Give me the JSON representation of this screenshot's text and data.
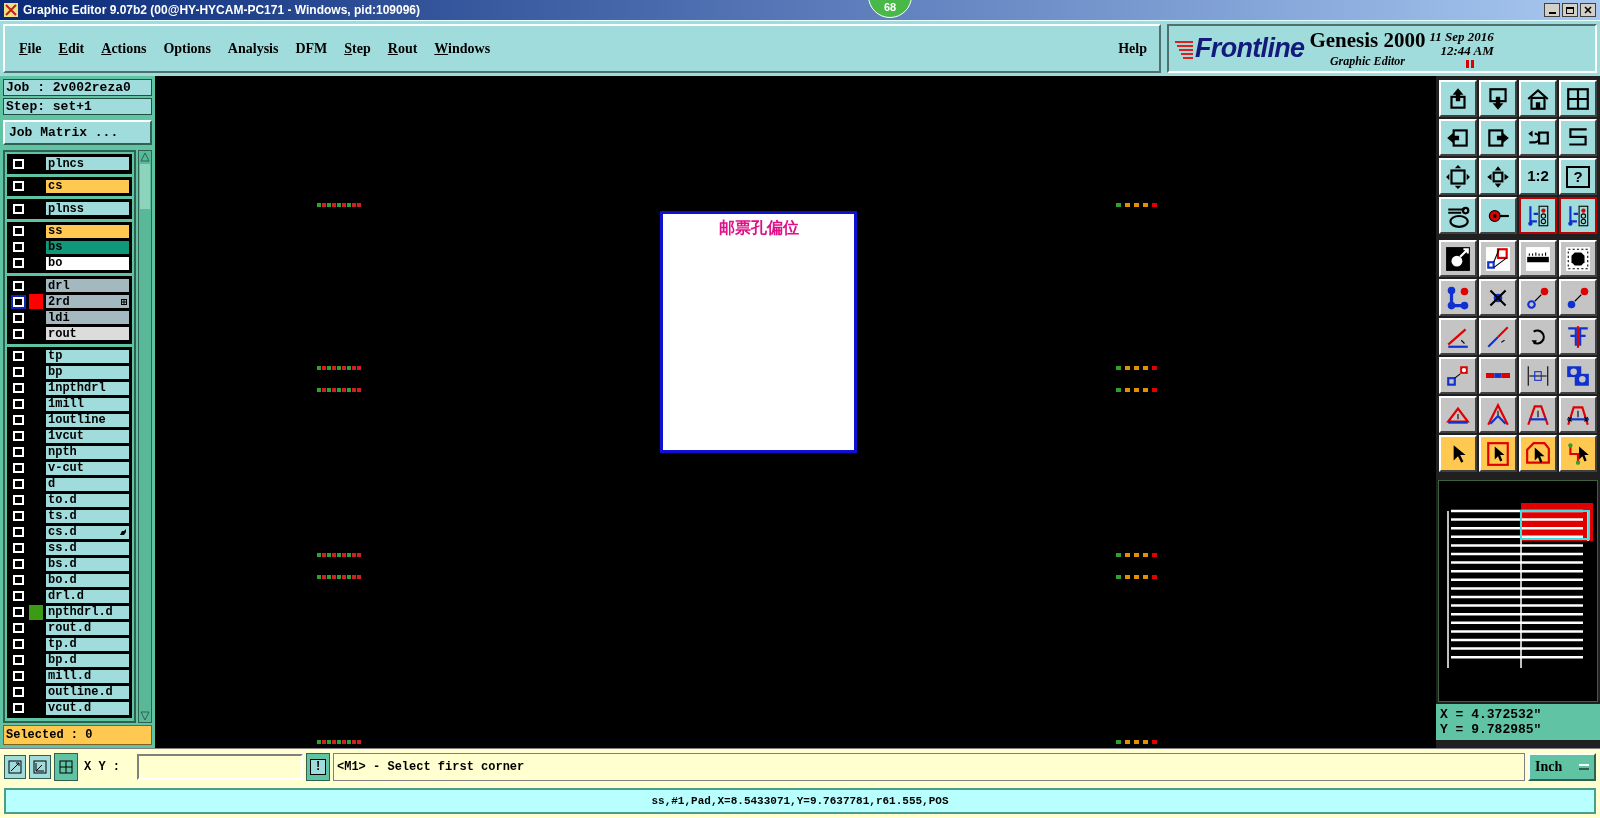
{
  "title_bar": {
    "title": "Graphic Editor 9.07b2 (00@HY-HYCAM-PC171 - Windows, pid:109096)",
    "badge": "68"
  },
  "menu": [
    {
      "label": "File",
      "underline_first": true
    },
    {
      "label": "Edit",
      "underline_first": true
    },
    {
      "label": "Actions",
      "underline_first": true
    },
    {
      "label": "Options",
      "underline_first": false
    },
    {
      "label": "Analysis",
      "underline_first": false
    },
    {
      "label": "DFM",
      "underline_first": false
    },
    {
      "label": "Step",
      "underline_first": true
    },
    {
      "label": "Rout",
      "underline_first": true
    },
    {
      "label": "Windows",
      "underline_first": true
    }
  ],
  "help": "Help",
  "brand": {
    "logo": "Frontline",
    "product": "Genesis 2000",
    "subtitle": "Graphic Editor",
    "date": "11 Sep 2016",
    "time": "12:44 AM"
  },
  "job": {
    "job": "Job : 2v002reza0",
    "step": "Step: set+1",
    "matrix_button": "Job Matrix ..."
  },
  "layer_groups": [
    [
      {
        "name": "plncs",
        "kind": "document",
        "selected": false
      }
    ],
    [
      {
        "name": "cs",
        "kind": "signal",
        "selected": false
      }
    ],
    [
      {
        "name": "plnss",
        "kind": "document",
        "selected": false
      }
    ],
    [
      {
        "name": "ss",
        "kind": "signal",
        "selected": false
      },
      {
        "name": "bs",
        "kind": "mask",
        "selected": false
      },
      {
        "name": "bo",
        "kind": "silk",
        "selected": false
      }
    ],
    [
      {
        "name": "drl",
        "kind": "drill",
        "selected": false
      },
      {
        "name": "2rd",
        "kind": "drill",
        "selected": true,
        "color": "#ff0000",
        "has_attributes": true
      },
      {
        "name": "ldi",
        "kind": "drill",
        "selected": false
      },
      {
        "name": "rout",
        "kind": "rout",
        "selected": false
      }
    ],
    [
      {
        "name": "tp",
        "kind": "document",
        "selected": false
      },
      {
        "name": "bp",
        "kind": "document",
        "selected": false
      },
      {
        "name": "1npthdrl",
        "kind": "document",
        "selected": false
      },
      {
        "name": "1mill",
        "kind": "document",
        "selected": false
      },
      {
        "name": "1outline",
        "kind": "document",
        "selected": false
      },
      {
        "name": "1vcut",
        "kind": "document",
        "selected": false
      },
      {
        "name": "npth",
        "kind": "document",
        "selected": false
      },
      {
        "name": "v-cut",
        "kind": "document",
        "selected": false
      },
      {
        "name": "d",
        "kind": "document",
        "selected": false
      },
      {
        "name": "to.d",
        "kind": "document",
        "selected": false
      },
      {
        "name": "ts.d",
        "kind": "document",
        "selected": false
      },
      {
        "name": "cs.d",
        "kind": "document",
        "selected": false,
        "has_pointer": true
      },
      {
        "name": "ss.d",
        "kind": "document",
        "selected": false
      },
      {
        "name": "bs.d",
        "kind": "document",
        "selected": false
      },
      {
        "name": "bo.d",
        "kind": "document",
        "selected": false
      },
      {
        "name": "drl.d",
        "kind": "document",
        "selected": false
      },
      {
        "name": "npthdrl.d",
        "kind": "document",
        "selected": false,
        "color": "#3c9a14"
      },
      {
        "name": "rout.d",
        "kind": "document",
        "selected": false
      },
      {
        "name": "tp.d",
        "kind": "document",
        "selected": false
      },
      {
        "name": "bp.d",
        "kind": "document",
        "selected": false
      },
      {
        "name": "mill.d",
        "kind": "document",
        "selected": false
      },
      {
        "name": "outline.d",
        "kind": "document",
        "selected": false
      },
      {
        "name": "vcut.d",
        "kind": "document",
        "selected": false
      }
    ]
  ],
  "selected_count": "Selected : 0",
  "canvas": {
    "note": "邮票孔偏位"
  },
  "toolbar": [
    {
      "kind": "view",
      "rows": [
        [
          {
            "kind": "export-up",
            "active": false
          },
          {
            "kind": "import-down",
            "active": false
          },
          {
            "kind": "home",
            "active": false
          },
          {
            "kind": "grid-xy",
            "active": false
          }
        ],
        [
          {
            "kind": "arrow-left",
            "active": false
          },
          {
            "kind": "arrow-right",
            "active": false
          },
          {
            "kind": "undo",
            "active": false
          },
          {
            "kind": "snake",
            "active": false
          }
        ],
        [
          {
            "kind": "zoom-out",
            "active": false
          },
          {
            "kind": "zoom-center",
            "active": false
          },
          {
            "kind": "label",
            "label": "1:2",
            "active": false
          },
          {
            "kind": "label-framed",
            "label": "?",
            "active": false
          }
        ],
        [
          {
            "kind": "tools",
            "active": false
          },
          {
            "kind": "probe",
            "active": false
          },
          {
            "kind": "circuit",
            "active": true
          },
          {
            "kind": "circuit",
            "active": true
          }
        ]
      ]
    },
    {
      "kind": "edit",
      "rows": [
        [
          {
            "kind": "pad-select",
            "active": false
          },
          {
            "kind": "copy-shape",
            "active": false
          },
          {
            "kind": "ruler",
            "active": false
          },
          {
            "kind": "dashed-pad",
            "active": false
          }
        ],
        [
          {
            "kind": "nodes",
            "active": false
          },
          {
            "kind": "cross-pad",
            "active": false
          },
          {
            "kind": "link-hollow",
            "active": false
          },
          {
            "kind": "link-filled",
            "active": false
          }
        ],
        [
          {
            "kind": "angle-line",
            "active": false
          },
          {
            "kind": "diag-line",
            "active": false
          },
          {
            "kind": "rotate",
            "active": false
          },
          {
            "kind": "mirror",
            "active": false
          }
        ],
        [
          {
            "kind": "resize-pad",
            "active": false
          },
          {
            "kind": "segment",
            "active": false
          },
          {
            "kind": "measure",
            "active": false
          },
          {
            "kind": "overlap",
            "active": false
          }
        ],
        [
          {
            "kind": "tri-flat",
            "active": false
          },
          {
            "kind": "tri-peak",
            "active": false
          },
          {
            "kind": "tri-arch",
            "active": false
          },
          {
            "kind": "tri-cross",
            "active": false
          }
        ]
      ]
    },
    {
      "kind": "select",
      "rows": [
        [
          {
            "kind": "pointer",
            "active": false
          },
          {
            "kind": "pointer-box",
            "active": false
          },
          {
            "kind": "pointer-octagon",
            "active": false
          },
          {
            "kind": "pointer-route",
            "active": false
          }
        ]
      ]
    }
  ],
  "coords": {
    "x": "X = 4.372532\"",
    "y": "Y = 9.782985\""
  },
  "command": {
    "xy_label": "X Y :",
    "alert": "!",
    "prompt": "<M1> - Select first corner",
    "units": "Inch"
  },
  "status": "ss,#1,Pad,X=8.5433071,Y=9.7637781,r61.555,POS"
}
